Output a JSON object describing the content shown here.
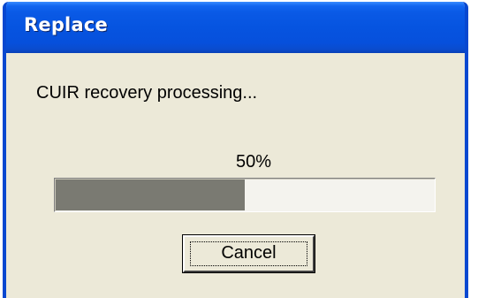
{
  "dialog": {
    "title": "Replace",
    "message": "CUIR recovery processing...",
    "progress": {
      "percent_label": "50%",
      "fraction": 0.5
    },
    "cancel_label": "Cancel"
  },
  "colors": {
    "titlebar": "#0654e0",
    "window_face": "#ece9d8",
    "progress_fill": "#7a7a72"
  }
}
